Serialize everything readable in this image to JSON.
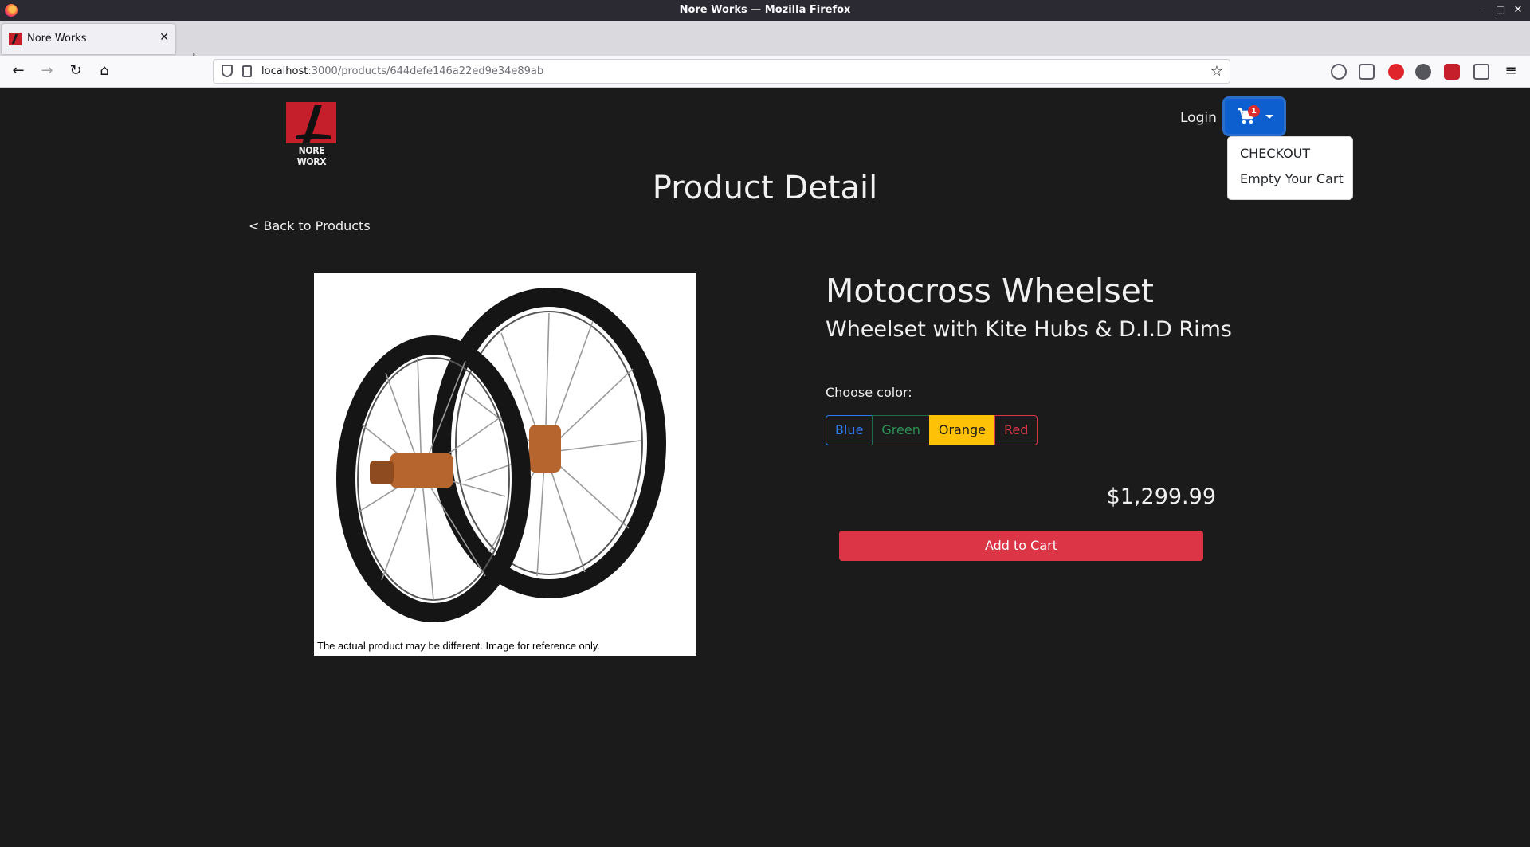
{
  "browser": {
    "window_title": "Nore Works — Mozilla Firefox",
    "tab_title": "Nore Works",
    "url_host": "localhost",
    "url_path": ":3000/products/644defe146a22ed9e34e89ab"
  },
  "header": {
    "logo_text": "NORE WORX",
    "login_label": "Login",
    "cart_count": "1",
    "dropdown": [
      "CHECKOUT",
      "Empty Your Cart"
    ]
  },
  "page": {
    "title": "Product Detail",
    "back_link": "< Back to Products"
  },
  "product": {
    "name": "Motocross Wheelset",
    "subtitle": "Wheelset with Kite Hubs & D.I.D Rims",
    "image_disclaimer": "The actual product may be different. Image for reference only.",
    "choose_color_label": "Choose color:",
    "colors": [
      "Blue",
      "Green",
      "Orange",
      "Red"
    ],
    "selected_color": "Orange",
    "price": "$1,299.99",
    "add_to_cart_label": "Add to Cart"
  },
  "theme": {
    "background": "#1b1b1b",
    "cart_button": "#0d5fd0",
    "add_to_cart": "#dc3545",
    "selected_color_bg": "#ffc107"
  }
}
